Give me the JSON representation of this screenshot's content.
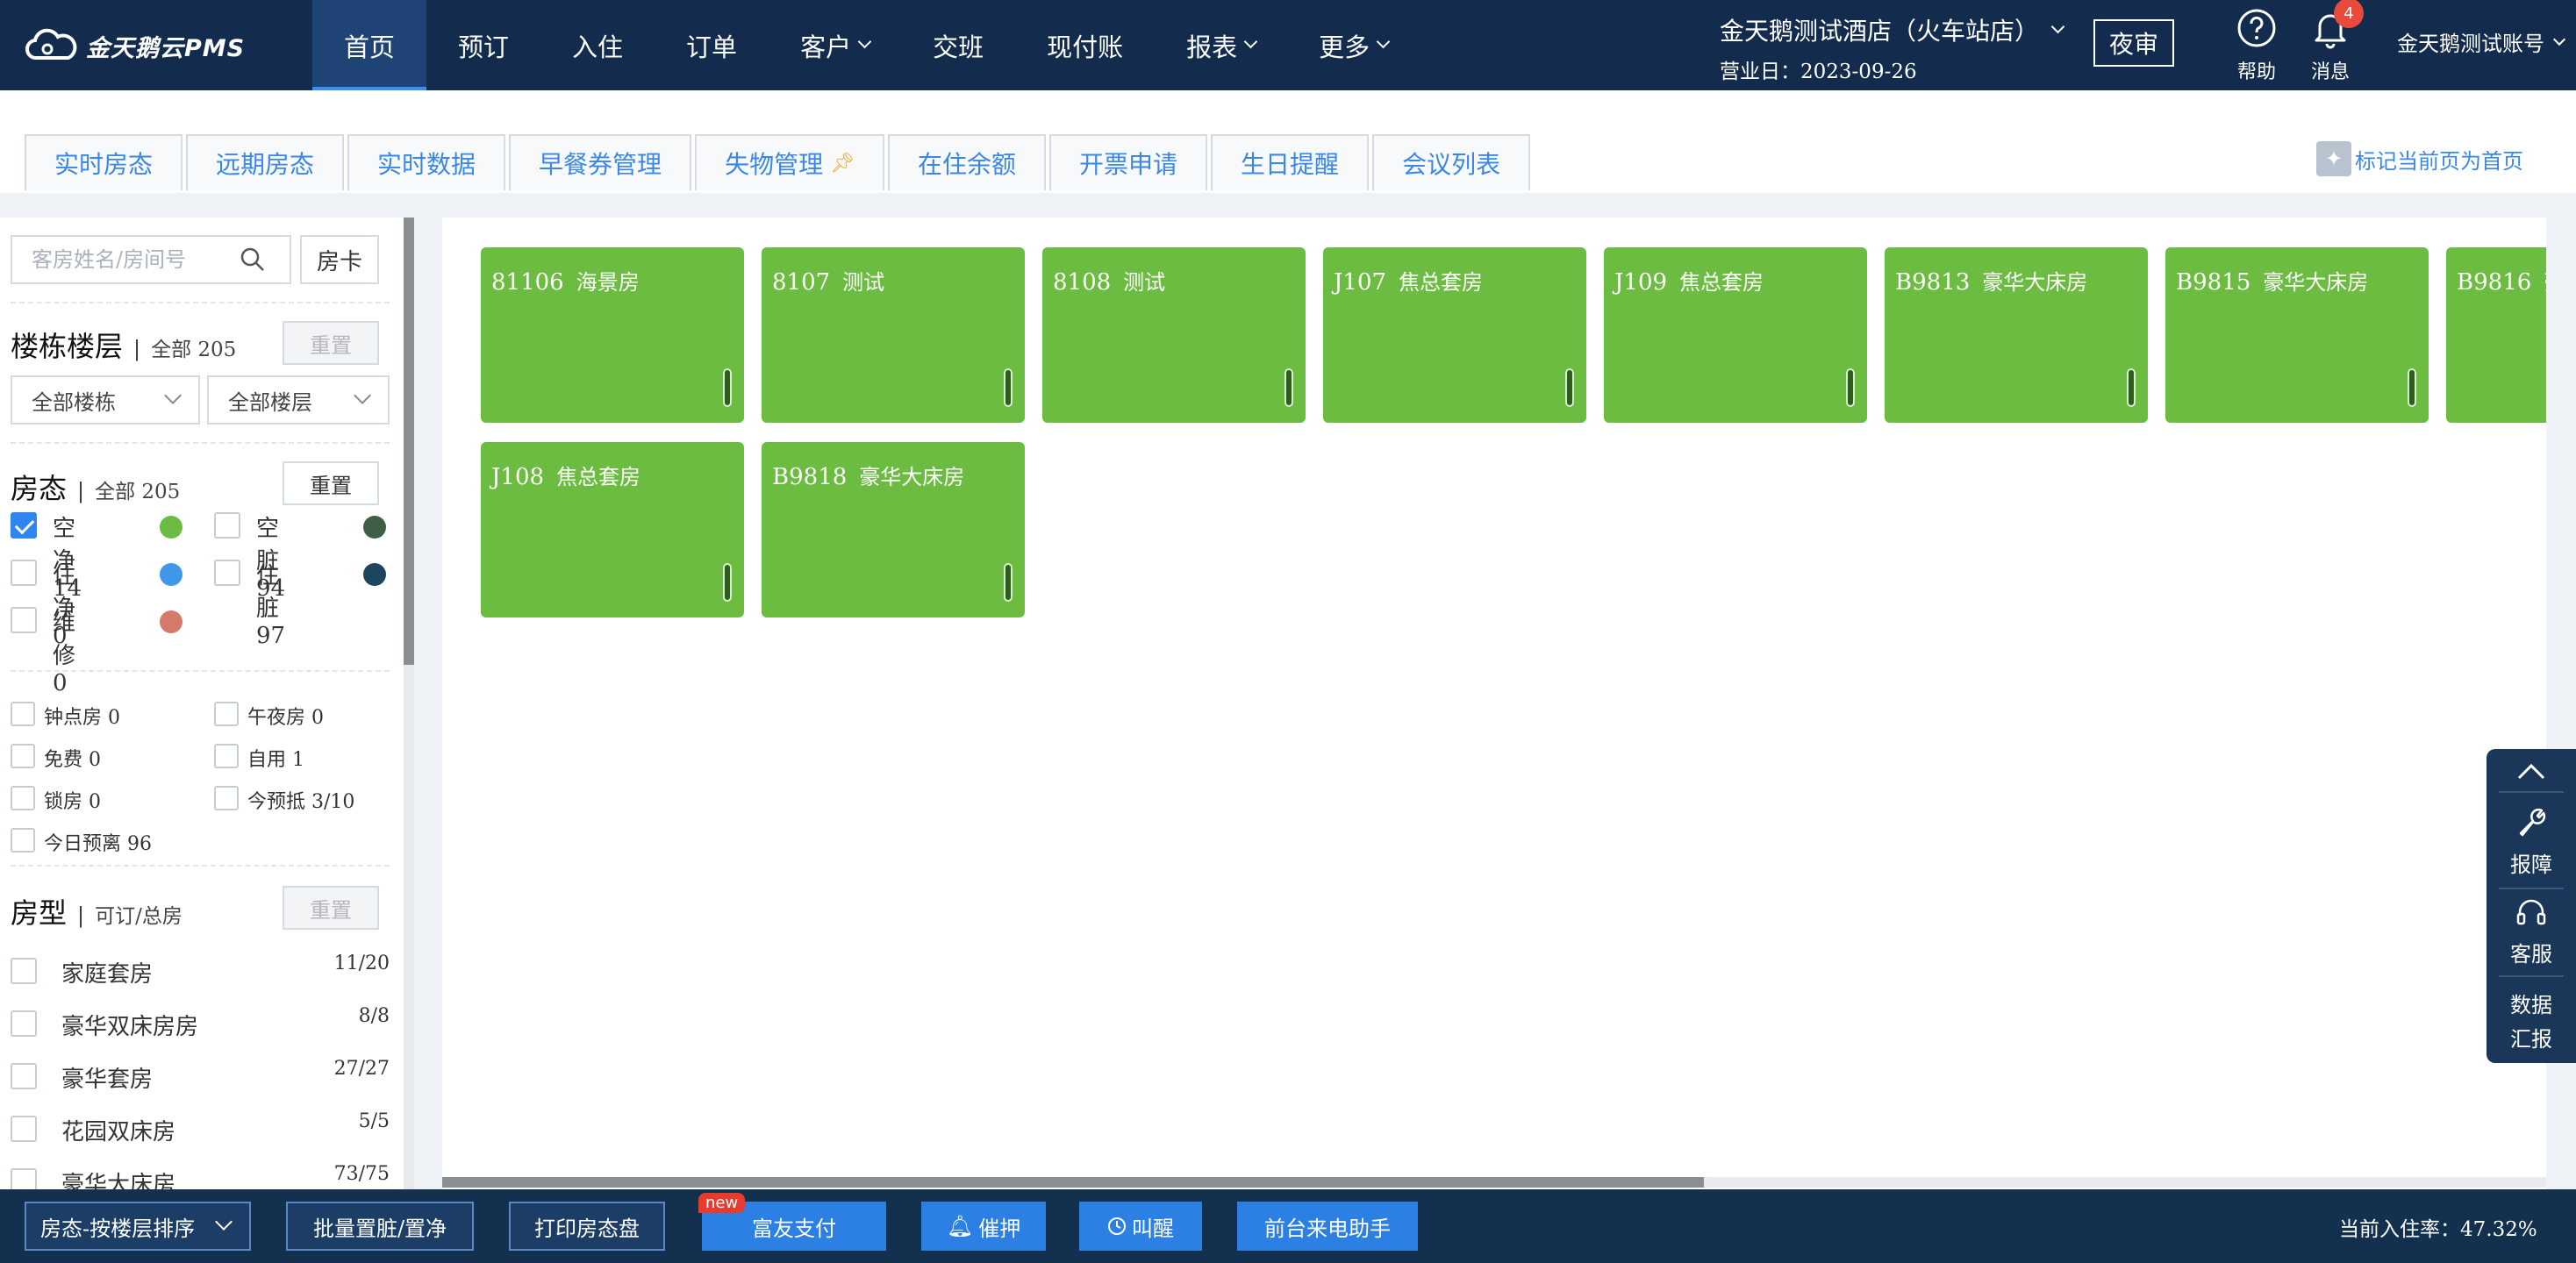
{
  "app": {
    "logo_text": "金天鹅云PMS"
  },
  "nav": [
    {
      "label": "首页",
      "active": true,
      "dropdown": false
    },
    {
      "label": "预订",
      "active": false,
      "dropdown": false
    },
    {
      "label": "入住",
      "active": false,
      "dropdown": false
    },
    {
      "label": "订单",
      "active": false,
      "dropdown": false
    },
    {
      "label": "客户",
      "active": false,
      "dropdown": true
    },
    {
      "label": "交班",
      "active": false,
      "dropdown": false
    },
    {
      "label": "现付账",
      "active": false,
      "dropdown": false
    },
    {
      "label": "报表",
      "active": false,
      "dropdown": true
    },
    {
      "label": "更多",
      "active": false,
      "dropdown": true
    }
  ],
  "header": {
    "hotel_name": "金天鹅测试酒店（火车站店）",
    "business_date": "营业日：2023-09-26",
    "audit_label": "夜审",
    "help_label": "帮助",
    "message_label": "消息",
    "message_count": "4",
    "account_label": "金天鹅测试账号"
  },
  "quick_tabs": [
    "实时房态",
    "远期房态",
    "实时数据",
    "早餐券管理",
    "失物管理",
    "在住余额",
    "开票申请",
    "生日提醒",
    "会议列表"
  ],
  "mark_home_label": "标记当前页为首页",
  "filters": {
    "search_placeholder": "客房姓名/房间号",
    "room_card_label": "房卡",
    "building_floor": {
      "title": "楼栋楼层",
      "summary": "全部 205",
      "reset": "重置",
      "building_select": "全部楼栋",
      "floor_select": "全部楼层"
    },
    "room_status": {
      "title": "房态",
      "summary": "全部 205",
      "reset": "重置",
      "items": [
        {
          "label": "空净 14",
          "checked": true,
          "color": "#6cbc42"
        },
        {
          "label": "空脏 94",
          "checked": false,
          "color": "#3f5f44"
        },
        {
          "label": "住净 0",
          "checked": false,
          "color": "#3f97e8"
        },
        {
          "label": "住脏 97",
          "checked": false,
          "color": "#1e4560"
        },
        {
          "label": "维修 0",
          "checked": false,
          "color": "#d47a6c"
        }
      ]
    },
    "flags": [
      {
        "label": "钟点房 0"
      },
      {
        "label": "午夜房 0"
      },
      {
        "label": "免费 0"
      },
      {
        "label": "自用 1"
      },
      {
        "label": "锁房 0"
      },
      {
        "label": "今预抵 3/10"
      },
      {
        "label": "今日预离 96"
      }
    ],
    "room_type": {
      "title": "房型",
      "summary": "可订/总房",
      "reset": "重置",
      "items": [
        {
          "label": "家庭套房",
          "count": "11/20"
        },
        {
          "label": "豪华双床房房",
          "count": "8/8"
        },
        {
          "label": "豪华套房",
          "count": "27/27"
        },
        {
          "label": "花园双床房",
          "count": "5/5"
        },
        {
          "label": "豪华大床房",
          "count": "73/75"
        }
      ]
    }
  },
  "rooms": [
    {
      "number": "81106",
      "type": "海景房"
    },
    {
      "number": "8107",
      "type": "测试"
    },
    {
      "number": "8108",
      "type": "测试"
    },
    {
      "number": "J107",
      "type": "焦总套房"
    },
    {
      "number": "J109",
      "type": "焦总套房"
    },
    {
      "number": "B9813",
      "type": "豪华大床房"
    },
    {
      "number": "B9815",
      "type": "豪华大床房"
    },
    {
      "number": "B9816",
      "type": "豪华大床房"
    },
    {
      "number": "J108",
      "type": "焦总套房"
    },
    {
      "number": "B9818",
      "type": "豪华大床房"
    }
  ],
  "right_tools": {
    "report_label": "报障",
    "service_label": "客服",
    "data_label_1": "数据",
    "data_label_2": "汇报"
  },
  "bottom": {
    "sort_select": "房态-按楼层排序",
    "batch_label": "批量置脏/置净",
    "print_label": "打印房态盘",
    "pay_label": "富友支付",
    "new_badge": "new",
    "deposit_label": "催押",
    "wake_label": "叫醒",
    "phone_label": "前台来电助手",
    "occupancy": "当前入住率：47.32%"
  },
  "colors": {
    "topbar": "#132b4d",
    "accent": "#3a87e6",
    "room_clean_vacant": "#6cbc42"
  }
}
